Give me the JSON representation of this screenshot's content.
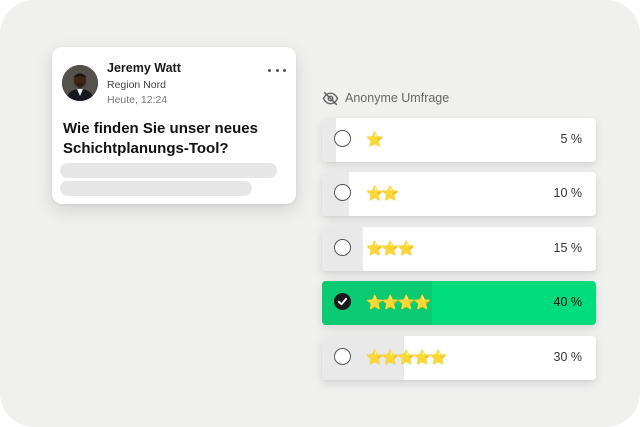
{
  "post": {
    "author_name": "Jeremy Watt",
    "region": "Region Nord",
    "time": "Heute, 12:24",
    "question": "Wie finden Sie unser neues Schichtplanungs-Tool?",
    "more_icon": "more-horizontal-icon"
  },
  "poll": {
    "header_label": "Anonyme Umfrage",
    "header_icon": "eye-off-icon",
    "accent_color": "#01dc7c",
    "options": [
      {
        "stars": "⭐",
        "rating": 1,
        "percent_label": "5 %",
        "share": 0.05,
        "selected": false
      },
      {
        "stars": "⭐⭐",
        "rating": 2,
        "percent_label": "10 %",
        "share": 0.1,
        "selected": false
      },
      {
        "stars": "⭐⭐⭐",
        "rating": 3,
        "percent_label": "15 %",
        "share": 0.15,
        "selected": false
      },
      {
        "stars": "⭐⭐⭐⭐",
        "rating": 4,
        "percent_label": "40 %",
        "share": 0.4,
        "selected": true
      },
      {
        "stars": "⭐⭐⭐⭐⭐",
        "rating": 5,
        "percent_label": "30 %",
        "share": 0.3,
        "selected": false
      }
    ]
  }
}
